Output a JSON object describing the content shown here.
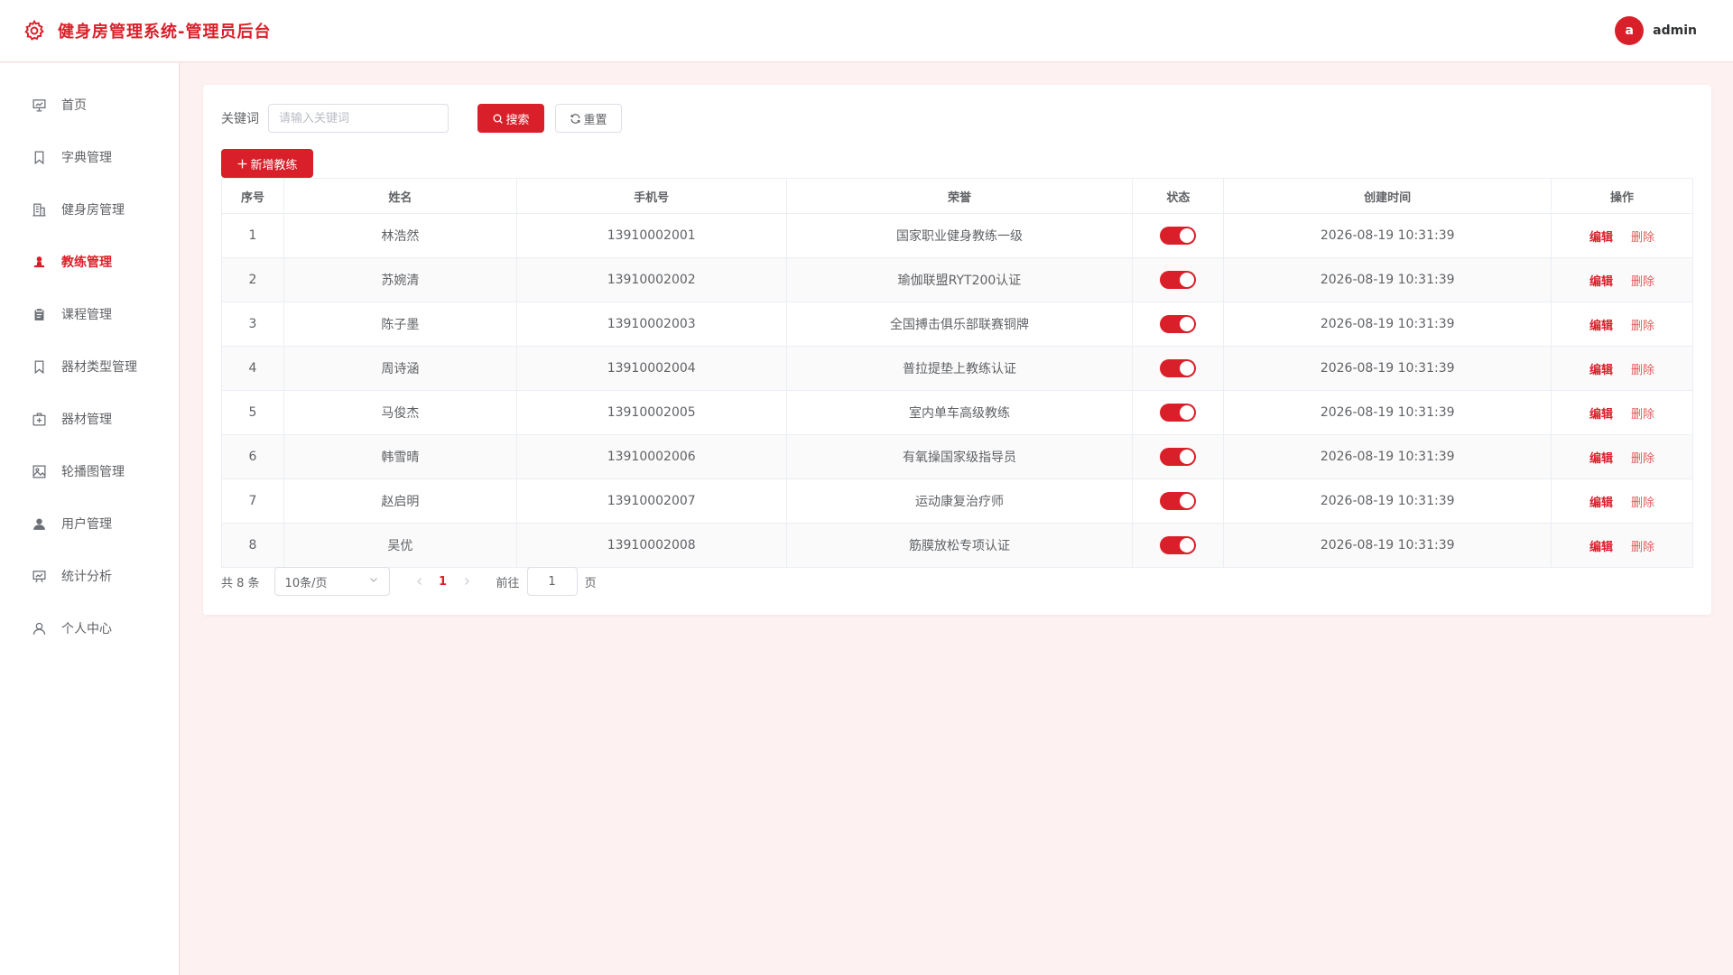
{
  "header": {
    "title": "健身房管理系统-管理员后台",
    "avatar_letter": "a",
    "username": "admin"
  },
  "sidebar": {
    "items": [
      {
        "label": "首页",
        "icon": "presentation-chart-icon",
        "active": false
      },
      {
        "label": "字典管理",
        "icon": "bookmark-icon",
        "active": false
      },
      {
        "label": "健身房管理",
        "icon": "building-icon",
        "active": false
      },
      {
        "label": "教练管理",
        "icon": "stamp-icon",
        "active": true
      },
      {
        "label": "课程管理",
        "icon": "clipboard-icon",
        "active": false
      },
      {
        "label": "器材类型管理",
        "icon": "bookmark-icon",
        "active": false
      },
      {
        "label": "器材管理",
        "icon": "first-aid-box-icon",
        "active": false
      },
      {
        "label": "轮播图管理",
        "icon": "picture-icon",
        "active": false
      },
      {
        "label": "用户管理",
        "icon": "user-filled-icon",
        "active": false
      },
      {
        "label": "统计分析",
        "icon": "data-board-icon",
        "active": false
      },
      {
        "label": "个人中心",
        "icon": "user-outline-icon",
        "active": false
      }
    ]
  },
  "search": {
    "label": "关键词",
    "placeholder": "请输入关键词",
    "search_button": "搜索",
    "reset_button": "重置",
    "add_button": "新增教练"
  },
  "table": {
    "columns": [
      "序号",
      "姓名",
      "手机号",
      "荣誉",
      "状态",
      "创建时间",
      "操作"
    ],
    "edit_label": "编辑",
    "delete_label": "删除",
    "rows": [
      {
        "index": "1",
        "name": "林浩然",
        "phone": "13910002001",
        "honor": "国家职业健身教练一级",
        "enabled": true,
        "created": "2026-08-19 10:31:39"
      },
      {
        "index": "2",
        "name": "苏婉清",
        "phone": "13910002002",
        "honor": "瑜伽联盟RYT200认证",
        "enabled": true,
        "created": "2026-08-19 10:31:39"
      },
      {
        "index": "3",
        "name": "陈子墨",
        "phone": "13910002003",
        "honor": "全国搏击俱乐部联赛铜牌",
        "enabled": true,
        "created": "2026-08-19 10:31:39"
      },
      {
        "index": "4",
        "name": "周诗涵",
        "phone": "13910002004",
        "honor": "普拉提垫上教练认证",
        "enabled": true,
        "created": "2026-08-19 10:31:39"
      },
      {
        "index": "5",
        "name": "马俊杰",
        "phone": "13910002005",
        "honor": "室内单车高级教练",
        "enabled": true,
        "created": "2026-08-19 10:31:39"
      },
      {
        "index": "6",
        "name": "韩雪晴",
        "phone": "13910002006",
        "honor": "有氧操国家级指导员",
        "enabled": true,
        "created": "2026-08-19 10:31:39"
      },
      {
        "index": "7",
        "name": "赵启明",
        "phone": "13910002007",
        "honor": "运动康复治疗师",
        "enabled": true,
        "created": "2026-08-19 10:31:39"
      },
      {
        "index": "8",
        "name": "吴优",
        "phone": "13910002008",
        "honor": "筋膜放松专项认证",
        "enabled": true,
        "created": "2026-08-19 10:31:39"
      }
    ]
  },
  "pagination": {
    "total_text": "共 8 条",
    "page_size": "10条/页",
    "current_page": "1",
    "goto_label": "前往",
    "goto_value": "1",
    "page_suffix": "页"
  },
  "colors": {
    "accent": "#d9202a",
    "background": "#fdf1f1"
  }
}
